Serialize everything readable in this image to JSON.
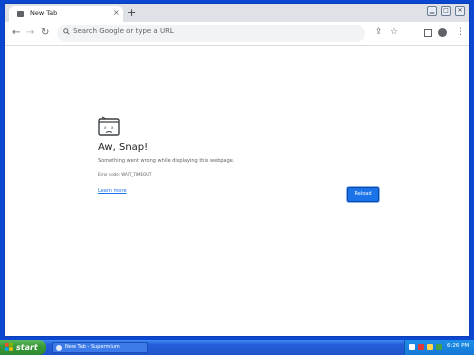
{
  "browser": {
    "tab_title": "New Tab",
    "new_tab_label": "+",
    "close_tab_label": "×",
    "omnibox_placeholder": "Search Google or type a URL"
  },
  "error_page": {
    "title": "Aw, Snap!",
    "description": "Something went wrong while displaying this webpage.",
    "error_code": "Error code: WAIT_TIMEOUT",
    "learn_more": "Learn more",
    "reload_label": "Reload"
  },
  "taskbar": {
    "start_label": "start",
    "task_button_label": "New Tab - Supermium",
    "clock": "6:26 PM"
  },
  "colors": {
    "accent": "#1a73e8",
    "titlebar": "#0b47d1",
    "taskbar": "#245edb",
    "start_button": "#3a9b3a"
  }
}
